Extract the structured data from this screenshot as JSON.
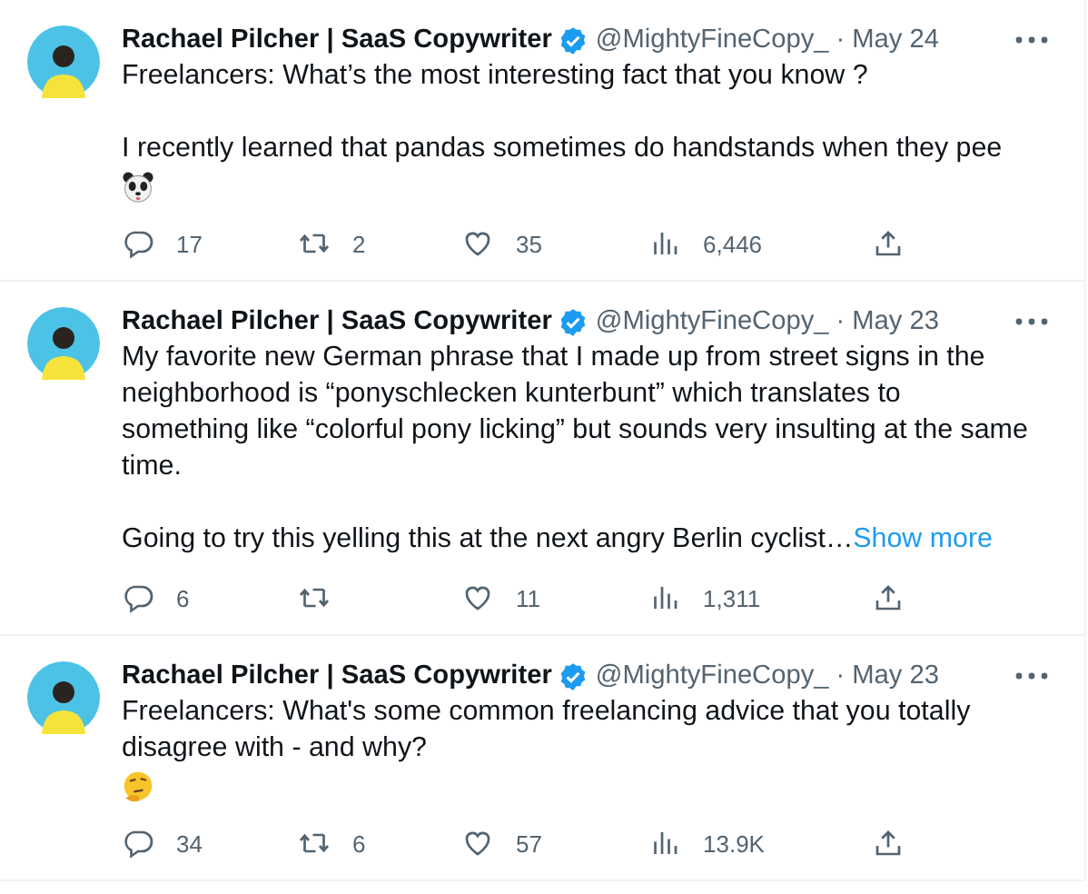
{
  "tweets": [
    {
      "name": "Rachael Pilcher | SaaS Copywriter",
      "verified": true,
      "handle": "@MightyFineCopy_",
      "separator": "·",
      "date": "May 24",
      "blocks": [
        {
          "kind": "text",
          "text": "Freelancers: What’s the most interesting fact that you know ?"
        },
        {
          "kind": "text",
          "text": "I recently learned that pandas sometimes do handstands when they pee"
        },
        {
          "kind": "panda"
        }
      ],
      "stats": {
        "replies": "17",
        "retweets": "2",
        "likes": "35",
        "views": "6,446"
      }
    },
    {
      "name": "Rachael Pilcher | SaaS Copywriter",
      "verified": true,
      "handle": "@MightyFineCopy_",
      "separator": "·",
      "date": "May 23",
      "blocks": [
        {
          "kind": "text",
          "text": "My favorite new German phrase that I made up from street signs in the neighborhood is “ponyschlecken kunterbunt” which translates to something like “colorful pony licking” but sounds very insulting at the same time."
        },
        {
          "kind": "text",
          "text": "Going to try this yelling this at the next angry Berlin cyclist…",
          "show_more": "Show more"
        }
      ],
      "stats": {
        "replies": "6",
        "likes": "11",
        "views": "1,311"
      }
    },
    {
      "name": "Rachael Pilcher | SaaS Copywriter",
      "verified": true,
      "handle": "@MightyFineCopy_",
      "separator": "·",
      "date": "May 23",
      "blocks": [
        {
          "kind": "text",
          "text": "Freelancers: What's some common freelancing advice that you totally disagree with - and why?"
        },
        {
          "kind": "thinking"
        }
      ],
      "stats": {
        "replies": "34",
        "retweets": "6",
        "likes": "57",
        "views": "13.9K"
      }
    }
  ]
}
